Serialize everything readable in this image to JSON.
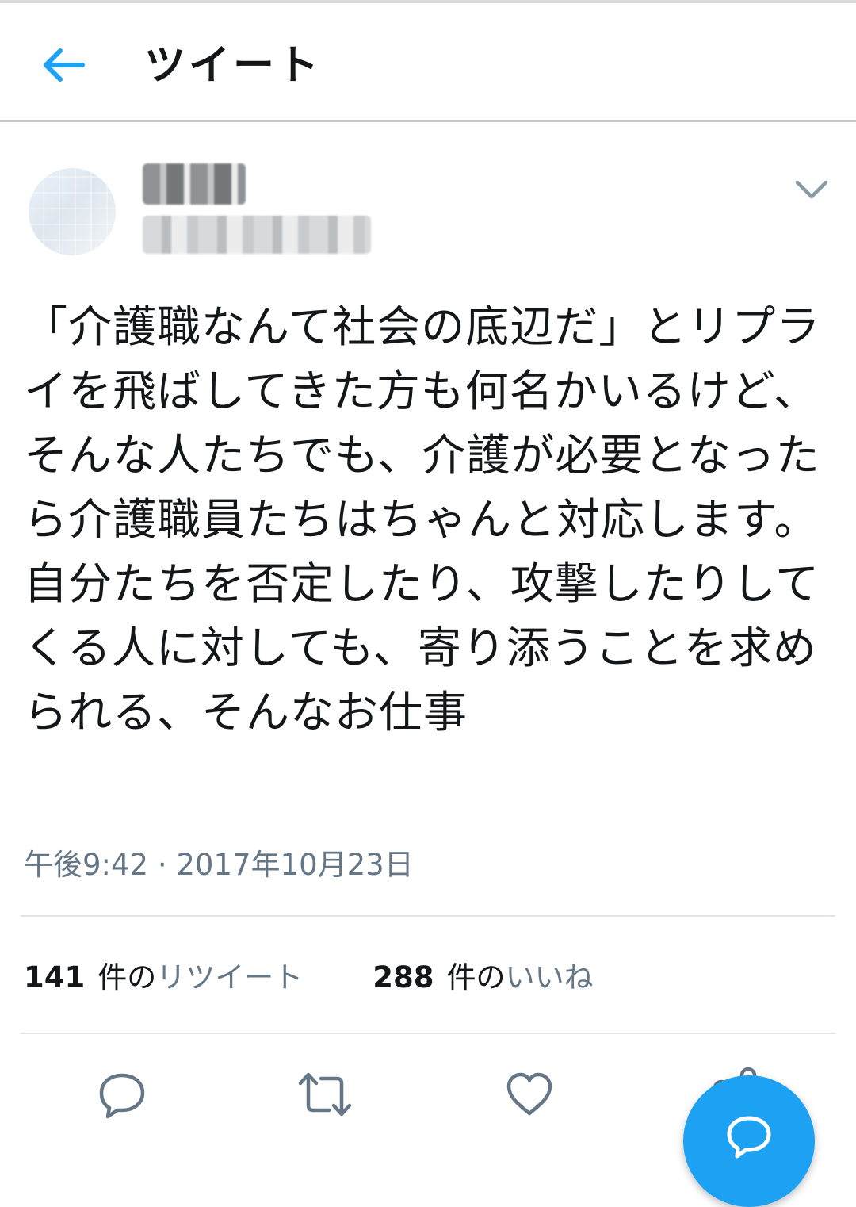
{
  "header": {
    "title": "ツイート",
    "back_icon": "arrow-left-icon"
  },
  "tweet": {
    "text": "「介護職なんて社会の底辺だ」とリプライを飛ばしてきた方も何名かいるけど、そんな人たちでも、介護が必要となったら介護職員たちはちゃんと対応します。自分たちを否定したり、攻撃したりしてくる人に対しても、寄り添うことを求められる、そんなお仕事",
    "timestamp": "午後9:42 · 2017年10月23日",
    "menu_icon": "chevron-down-icon"
  },
  "stats": {
    "retweets": {
      "count": "141",
      "unit": "件の",
      "label": "リツイート"
    },
    "likes": {
      "count": "288",
      "unit": "件の",
      "label": "いいね"
    }
  },
  "actions": {
    "reply_icon": "reply-icon",
    "retweet_icon": "retweet-icon",
    "like_icon": "heart-icon",
    "share_icon": "share-icon"
  },
  "fab": {
    "icon": "compose-icon"
  },
  "colors": {
    "accent": "#1da1f2",
    "text": "#14171a",
    "secondary": "#657786",
    "divider": "#e1e8ed"
  }
}
